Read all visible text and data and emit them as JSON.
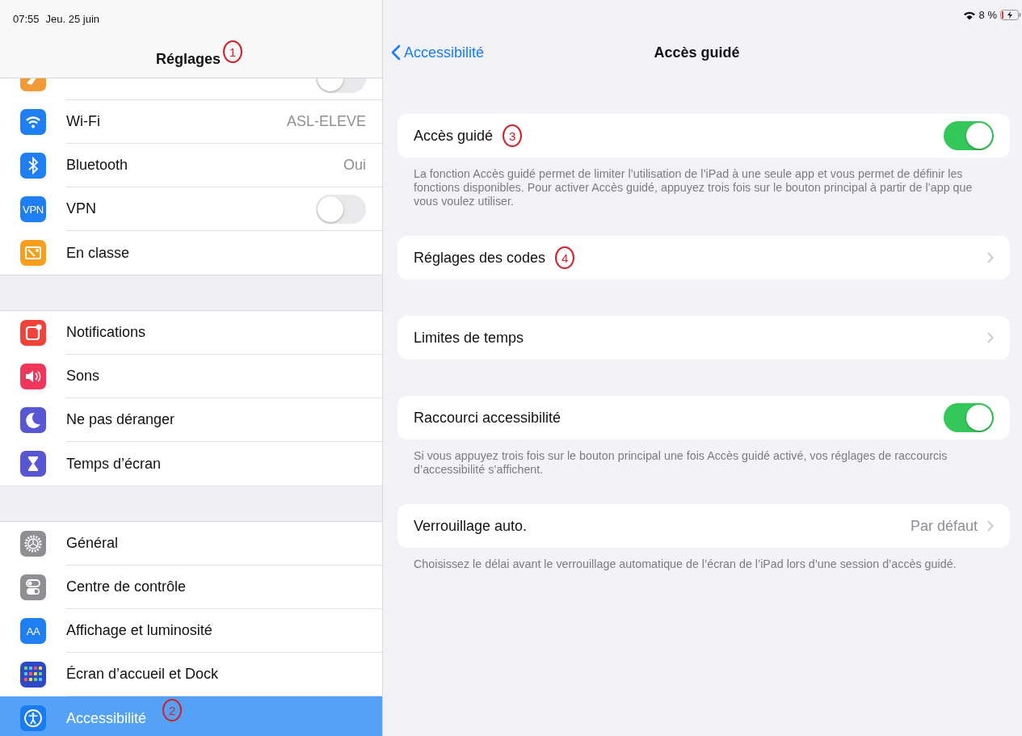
{
  "status_bar": {
    "time": "07:55",
    "date": "Jeu. 25 juin",
    "battery_percent": "8 %"
  },
  "sidebar": {
    "title": "Réglages",
    "annotation": "1",
    "groups": [
      [
        {
          "kind": "toggle",
          "on": false,
          "color": "#f19a37",
          "selected": false
        },
        {
          "label": "Wi-Fi",
          "kind": "value",
          "value": "ASL-ELEVE",
          "color": "#1e7ef2",
          "selected": false
        },
        {
          "label": "Bluetooth",
          "kind": "value",
          "value": "Oui",
          "color": "#1e7ef2",
          "selected": false
        },
        {
          "label": "VPN",
          "kind": "toggle",
          "on": false,
          "icon_text": "VPN",
          "color": "#1e7ef2",
          "selected": false
        },
        {
          "label": "En classe",
          "kind": "plain",
          "color": "#f59f1c",
          "selected": false
        }
      ],
      [
        {
          "label": "Notifications",
          "kind": "plain",
          "color": "#f0443a",
          "selected": false
        },
        {
          "label": "Sons",
          "kind": "plain",
          "color": "#f0365a",
          "selected": false
        },
        {
          "label": "Ne pas déranger",
          "kind": "plain",
          "color": "#5956d6",
          "selected": false
        },
        {
          "label": "Temps d’écran",
          "kind": "plain",
          "color": "#5956d6",
          "selected": false
        }
      ],
      [
        {
          "label": "Général",
          "kind": "plain",
          "color": "#8e8e93",
          "selected": false
        },
        {
          "label": "Centre de contrôle",
          "kind": "plain",
          "color": "#8e8e93",
          "selected": false
        },
        {
          "label": "Affichage et luminosité",
          "kind": "plain",
          "icon_text": "AA",
          "color": "#1e7ef2",
          "selected": false
        },
        {
          "label": "Écran d’accueil et Dock",
          "kind": "plain",
          "color": "#2e49c8",
          "selected": false
        },
        {
          "label": "Accessibilité",
          "kind": "plain",
          "color": "#1b7cf0",
          "selected": true,
          "annotation": "2"
        }
      ]
    ]
  },
  "detail": {
    "back": "Accessibilité",
    "title": "Accès guidé",
    "sections": [
      {
        "rows": [
          {
            "label": "Accès guidé",
            "kind": "toggle",
            "on": true,
            "annotation": "3"
          }
        ],
        "footer": "La fonction Accès guidé permet de limiter l’utilisation de l’iPad à une seule app et vous permet de définir les fonctions disponibles. Pour activer Accès guidé, appuyez trois fois sur le bouton principal à partir de l’app que vous voulez utiliser."
      },
      {
        "rows": [
          {
            "label": "Réglages des codes",
            "kind": "link",
            "annotation": "4"
          }
        ]
      },
      {
        "rows": [
          {
            "label": "Limites de temps",
            "kind": "link"
          }
        ]
      },
      {
        "rows": [
          {
            "label": "Raccourci accessibilité",
            "kind": "toggle",
            "on": true
          }
        ],
        "footer": "Si vous appuyez trois fois sur le bouton principal une fois Accès guidé activé, vos réglages de raccourcis d’accessibilité s’affichent."
      },
      {
        "rows": [
          {
            "label": "Verrouillage auto.",
            "kind": "link",
            "value": "Par défaut"
          }
        ],
        "footer": "Choisissez le délai avant le verrouillage automatique de l’écran de l’iPad lors d’une session d’accès guidé."
      }
    ]
  }
}
